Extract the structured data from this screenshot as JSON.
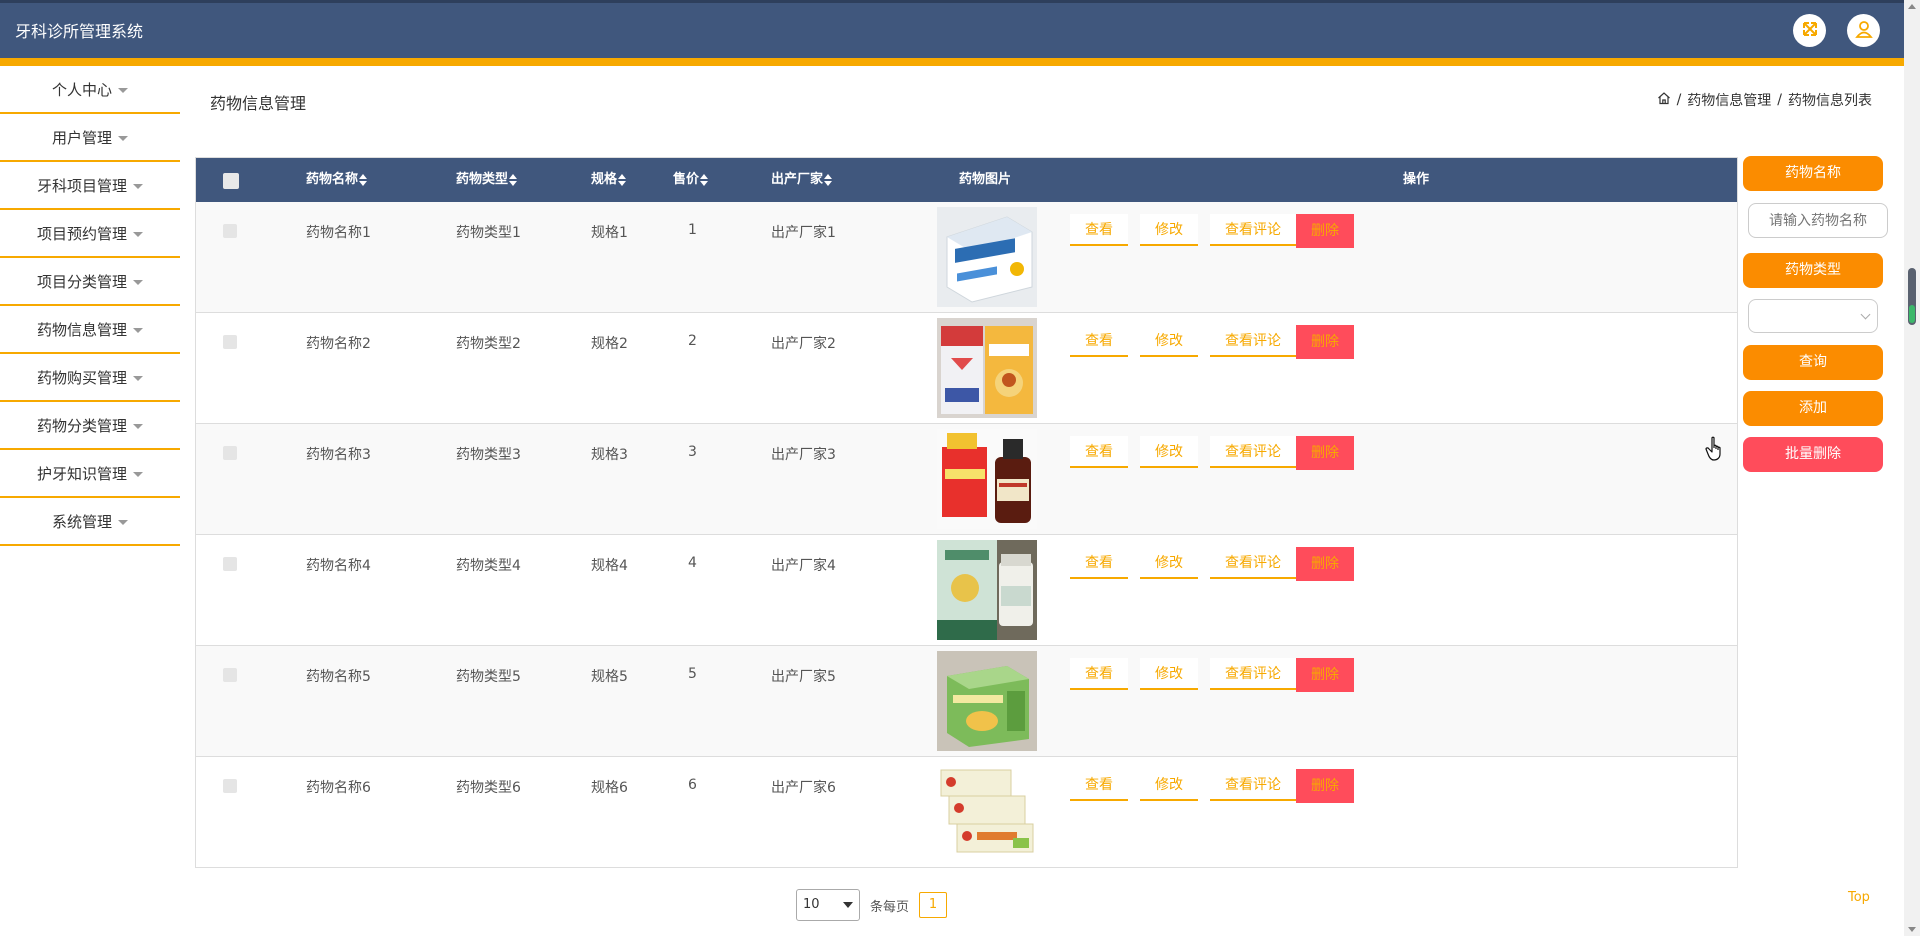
{
  "app": {
    "title": "牙科诊所管理系统"
  },
  "colors": {
    "header": "#40577d",
    "accent": "#f7a900",
    "primary_button": "#fb8c00",
    "danger": "#ff4c5b"
  },
  "header_icons": [
    "fullscreen-icon",
    "user-icon"
  ],
  "sidebar": {
    "items": [
      {
        "label": "个人中心"
      },
      {
        "label": "用户管理"
      },
      {
        "label": "牙科项目管理"
      },
      {
        "label": "项目预约管理"
      },
      {
        "label": "项目分类管理"
      },
      {
        "label": "药物信息管理"
      },
      {
        "label": "药物购买管理"
      },
      {
        "label": "药物分类管理"
      },
      {
        "label": "护牙知识管理"
      },
      {
        "label": "系统管理"
      }
    ]
  },
  "page": {
    "title": "药物信息管理",
    "breadcrumb": [
      "药物信息管理",
      "药物信息列表"
    ],
    "breadcrumb_sep": "/"
  },
  "table": {
    "columns": {
      "name": "药物名称",
      "type": "药物类型",
      "spec": "规格",
      "price": "售价",
      "maker": "出产厂家",
      "image": "药物图片",
      "actions": "操作"
    },
    "action_labels": {
      "view": "查看",
      "edit": "修改",
      "comments": "查看评论",
      "delete": "删除"
    },
    "rows": [
      {
        "name": "药物名称1",
        "type": "药物类型1",
        "spec": "规格1",
        "price": "1",
        "maker": "出产厂家1"
      },
      {
        "name": "药物名称2",
        "type": "药物类型2",
        "spec": "规格2",
        "price": "2",
        "maker": "出产厂家2"
      },
      {
        "name": "药物名称3",
        "type": "药物类型3",
        "spec": "规格3",
        "price": "3",
        "maker": "出产厂家3"
      },
      {
        "name": "药物名称4",
        "type": "药物类型4",
        "spec": "规格4",
        "price": "4",
        "maker": "出产厂家4"
      },
      {
        "name": "药物名称5",
        "type": "药物类型5",
        "spec": "规格5",
        "price": "5",
        "maker": "出产厂家5"
      },
      {
        "name": "药物名称6",
        "type": "药物类型6",
        "spec": "规格6",
        "price": "6",
        "maker": "出产厂家6"
      }
    ]
  },
  "search_panel": {
    "name_label": "药物名称",
    "name_placeholder": "请输入药物名称",
    "type_label": "药物类型",
    "type_value": "",
    "query_button": "查询",
    "add_button": "添加",
    "batch_delete_button": "批量删除"
  },
  "pagination": {
    "page_size": "10",
    "per_page_label": "条每页",
    "current_page": "1"
  },
  "top_link": "Top"
}
